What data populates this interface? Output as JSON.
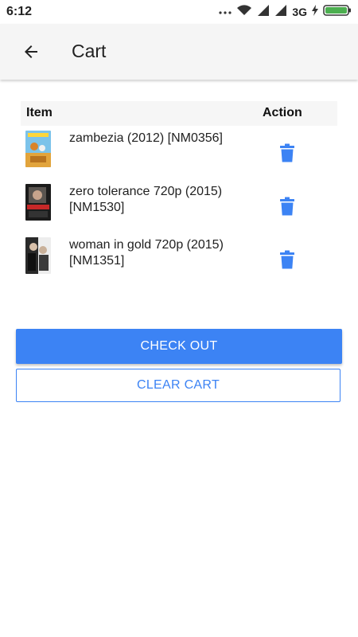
{
  "status_bar": {
    "time": "6:12",
    "network": "3G",
    "icons": [
      "dots-icon",
      "wifi-icon",
      "signal-icon",
      "signal-icon",
      "network-label",
      "charging-icon",
      "battery-icon"
    ]
  },
  "app_bar": {
    "back_icon": "arrow-left-icon",
    "title": "Cart"
  },
  "cart": {
    "headers": {
      "item": "Item",
      "action": "Action"
    },
    "items": [
      {
        "name": "zambezia (2012) [NM0356]",
        "thumbnail": "zambezia-poster",
        "action_icon": "trash-icon"
      },
      {
        "name": "zero tolerance 720p (2015) [NM1530]",
        "thumbnail": "zero-tolerance-poster",
        "action_icon": "trash-icon"
      },
      {
        "name": "woman in gold 720p (2015) [NM1351]",
        "thumbnail": "woman-in-gold-poster",
        "action_icon": "trash-icon"
      }
    ]
  },
  "buttons": {
    "checkout": "CHECK OUT",
    "clear": "CLEAR CART"
  },
  "colors": {
    "accent": "#3c83f4",
    "app_bar_bg": "#f5f5f5",
    "battery": "#4caf50"
  }
}
